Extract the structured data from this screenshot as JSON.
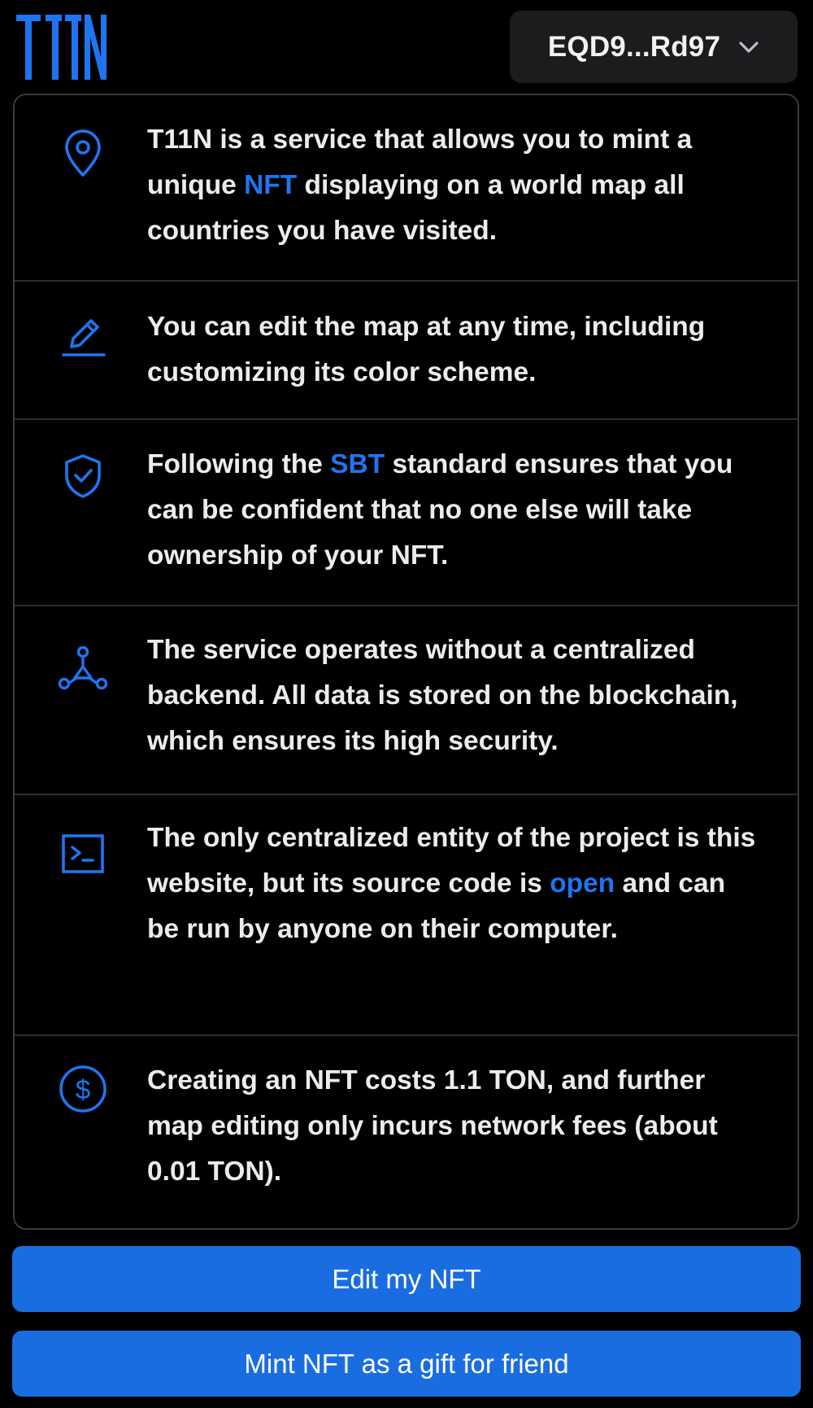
{
  "brand": {
    "logo_text": "T11N",
    "accent_color": "#1f75f0"
  },
  "header": {
    "wallet_label": "EQD9...Rd97",
    "wallet_icon": "chevron-down-icon"
  },
  "features": [
    {
      "icon": "map-pin-icon",
      "parts": [
        {
          "text": "T11N is a service that allows you to mint a unique "
        },
        {
          "text": "NFT",
          "link": true
        },
        {
          "text": " displaying on a world map all countries you have visited."
        }
      ]
    },
    {
      "icon": "pencil-icon",
      "parts": [
        {
          "text": "You can edit the map at any time, including customizing its color scheme."
        }
      ]
    },
    {
      "icon": "shield-check-icon",
      "parts": [
        {
          "text": "Following the "
        },
        {
          "text": "SBT",
          "link": true
        },
        {
          "text": " standard ensures that you can be confident that no one else will take ownership of your NFT."
        }
      ]
    },
    {
      "icon": "network-icon",
      "parts": [
        {
          "text": "The service operates without a centralized backend. All data is stored on the blockchain, which ensures its high security."
        }
      ]
    },
    {
      "icon": "terminal-icon",
      "parts": [
        {
          "text": "The only centralized entity of the project is this website, but its source code is "
        },
        {
          "text": "open",
          "link": true
        },
        {
          "text": " and can be run by anyone on their computer."
        }
      ]
    },
    {
      "icon": "dollar-icon",
      "parts": [
        {
          "text": "Creating an NFT costs 1.1 TON, and further map editing only incurs network fees (about 0.01 TON)."
        }
      ]
    }
  ],
  "actions": {
    "edit_label": "Edit my NFT",
    "mint_gift_label": "Mint NFT as a gift for friend"
  }
}
